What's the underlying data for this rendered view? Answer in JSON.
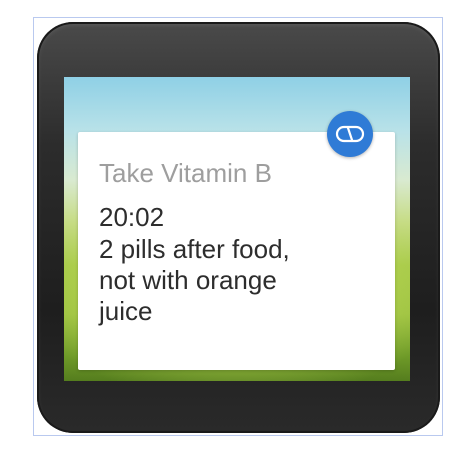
{
  "notification": {
    "title": "Take Vitamin B",
    "time": "20:02",
    "note_lines": [
      "2 pills after food,",
      "not with orange",
      "juice"
    ],
    "app_icon": "pill-icon"
  },
  "colors": {
    "bezel": "#2c2c2c",
    "card_background": "#ffffff",
    "title_text": "#9e9e9e",
    "body_text": "#2d2d2d",
    "badge": "#2f7bd6"
  }
}
